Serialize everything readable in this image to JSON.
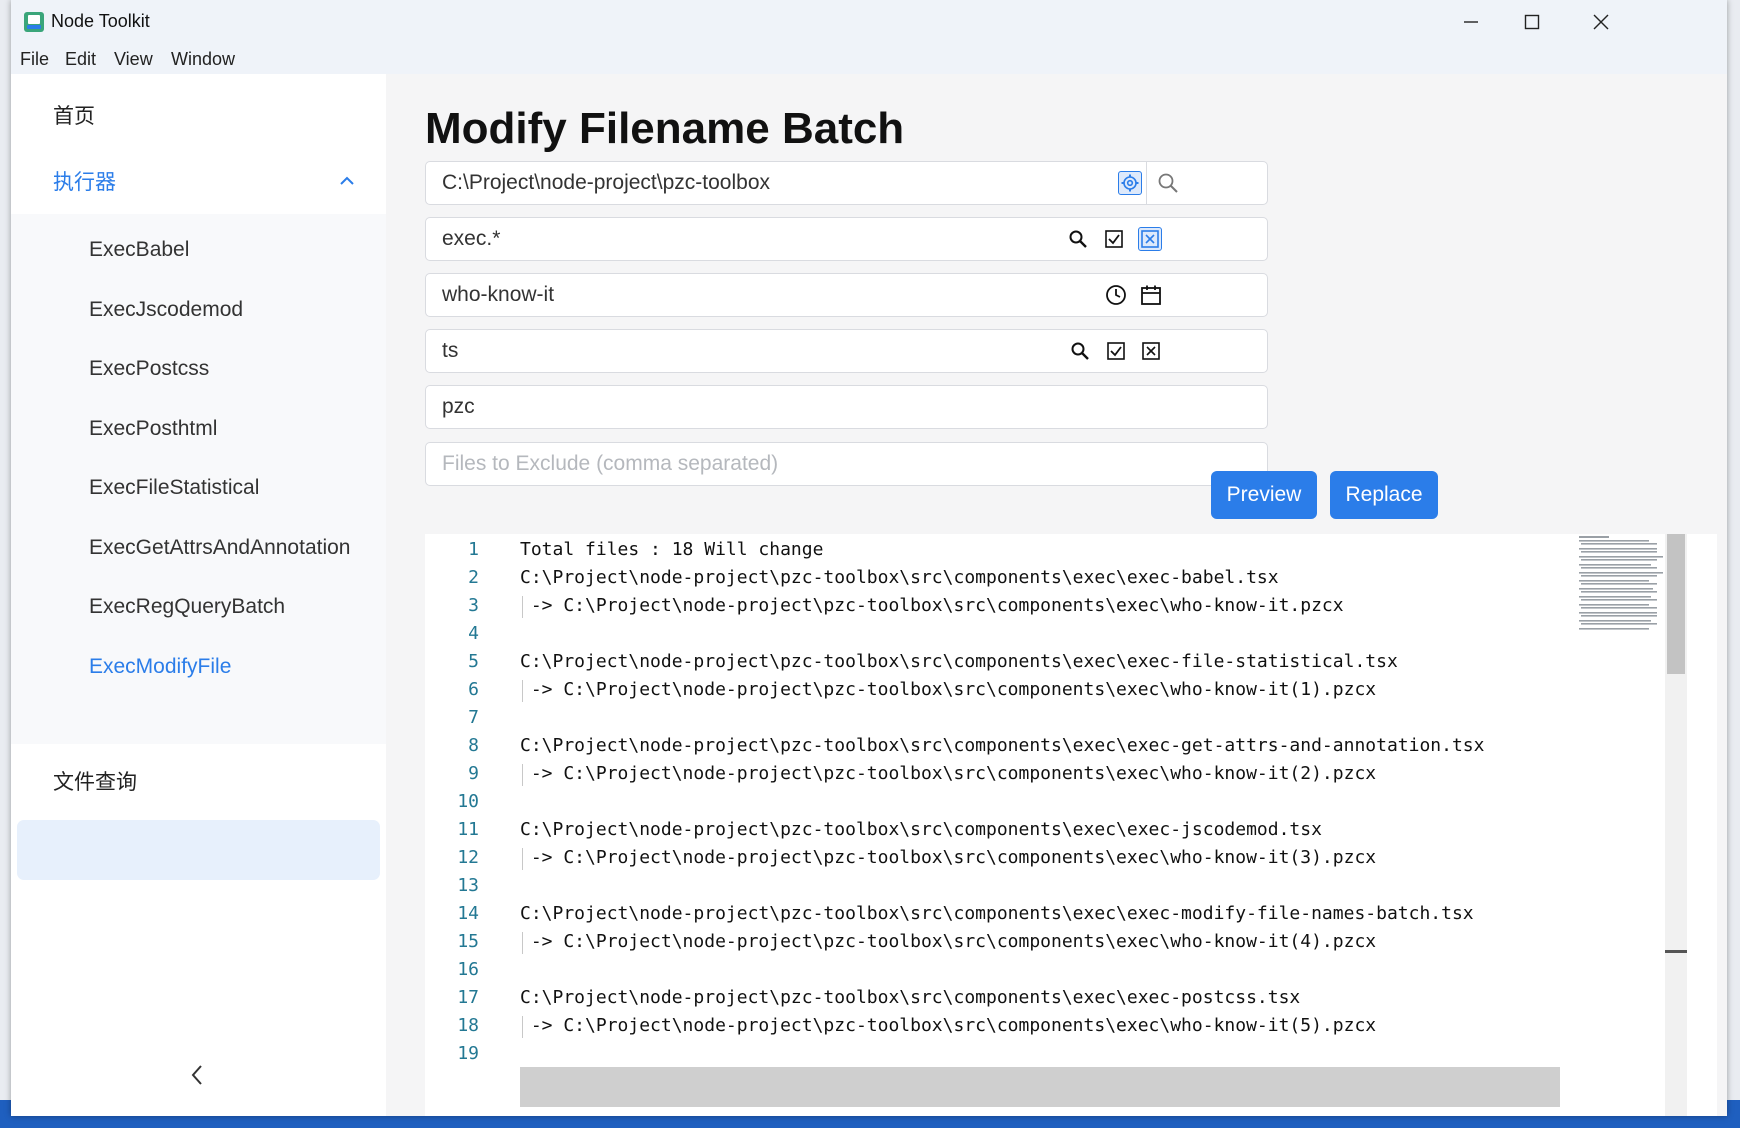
{
  "window": {
    "title": "Node Toolkit"
  },
  "menubar": [
    "File",
    "Edit",
    "View",
    "Window"
  ],
  "sidebar": {
    "home": "首页",
    "group": "执行器",
    "items": [
      "ExecBabel",
      "ExecJscodemod",
      "ExecPostcss",
      "ExecPosthtml",
      "ExecFileStatistical",
      "ExecGetAttrsAndAnnotation",
      "ExecRegQueryBatch",
      "ExecModifyFile"
    ],
    "active_item": "ExecModifyFile",
    "file_query": "文件查询",
    "collapse_glyph": "<"
  },
  "main": {
    "title": "Modify Filename Batch",
    "path_value": "C:\\Project\\node-project\\pzc-toolbox",
    "find_value": "exec.*",
    "replace_value": "who-know-it",
    "extension_value": "ts",
    "new_extension_value": "pzc",
    "exclude_placeholder": "Files to Exclude (comma separated)",
    "preview_label": "Preview",
    "replace_label": "Replace"
  },
  "editor": {
    "lines": [
      {
        "n": "1",
        "text": "Total files : 18 Will change",
        "indent": false
      },
      {
        "n": "2",
        "text": "C:\\Project\\node-project\\pzc-toolbox\\src\\components\\exec\\exec-babel.tsx",
        "indent": false
      },
      {
        "n": "3",
        "text": " -> C:\\Project\\node-project\\pzc-toolbox\\src\\components\\exec\\who-know-it.pzcx",
        "indent": true
      },
      {
        "n": "4",
        "text": "",
        "indent": false
      },
      {
        "n": "5",
        "text": "C:\\Project\\node-project\\pzc-toolbox\\src\\components\\exec\\exec-file-statistical.tsx",
        "indent": false
      },
      {
        "n": "6",
        "text": " -> C:\\Project\\node-project\\pzc-toolbox\\src\\components\\exec\\who-know-it(1).pzcx",
        "indent": true
      },
      {
        "n": "7",
        "text": "",
        "indent": false
      },
      {
        "n": "8",
        "text": "C:\\Project\\node-project\\pzc-toolbox\\src\\components\\exec\\exec-get-attrs-and-annotation.tsx",
        "indent": false
      },
      {
        "n": "9",
        "text": " -> C:\\Project\\node-project\\pzc-toolbox\\src\\components\\exec\\who-know-it(2).pzcx",
        "indent": true
      },
      {
        "n": "10",
        "text": "",
        "indent": false
      },
      {
        "n": "11",
        "text": "C:\\Project\\node-project\\pzc-toolbox\\src\\components\\exec\\exec-jscodemod.tsx",
        "indent": false
      },
      {
        "n": "12",
        "text": " -> C:\\Project\\node-project\\pzc-toolbox\\src\\components\\exec\\who-know-it(3).pzcx",
        "indent": true
      },
      {
        "n": "13",
        "text": "",
        "indent": false
      },
      {
        "n": "14",
        "text": "C:\\Project\\node-project\\pzc-toolbox\\src\\components\\exec\\exec-modify-file-names-batch.tsx",
        "indent": false
      },
      {
        "n": "15",
        "text": " -> C:\\Project\\node-project\\pzc-toolbox\\src\\components\\exec\\who-know-it(4).pzcx",
        "indent": true
      },
      {
        "n": "16",
        "text": "",
        "indent": false
      },
      {
        "n": "17",
        "text": "C:\\Project\\node-project\\pzc-toolbox\\src\\components\\exec\\exec-postcss.tsx",
        "indent": false
      },
      {
        "n": "18",
        "text": " -> C:\\Project\\node-project\\pzc-toolbox\\src\\components\\exec\\who-know-it(5).pzcx",
        "indent": true
      },
      {
        "n": "19",
        "text": "",
        "indent": false
      }
    ]
  },
  "colors": {
    "accent": "#2b7de9",
    "active_bg": "#e7f0fc",
    "line_number": "#237893"
  },
  "icons": [
    "app-icon",
    "minimize-icon",
    "maximize-icon",
    "close-icon",
    "chevron-up-icon",
    "chevron-left-icon",
    "settings-icon",
    "search-icon",
    "checkbox-icon",
    "clear-icon",
    "clock-icon",
    "calendar-icon"
  ]
}
